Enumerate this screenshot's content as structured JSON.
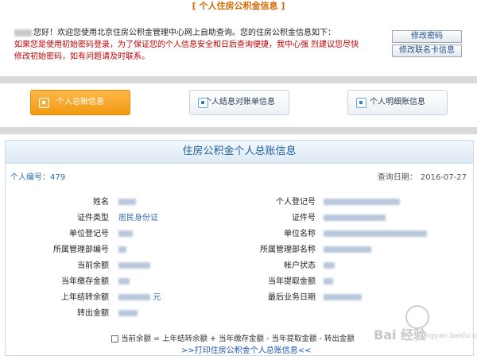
{
  "header": {
    "title": "[ 个人住房公积金信息 ]"
  },
  "greeting": {
    "line1": "您好！欢迎您使用北京住房公积金管理中心网上自助查询。您的住房公积金信息如下：",
    "notice": "如果您是使用初始密码登录，为了保证您的个人信息安全和日后查询便捷，我中心强 烈建议您尽快修改初始密码，如有问题请及时联系。"
  },
  "side_buttons": {
    "change_password": "修改密码",
    "change_card": "修改联名卡信息"
  },
  "tabs": [
    {
      "label": "个人总账信息",
      "active": true
    },
    {
      "label": "个人结息对账单信息",
      "active": false
    },
    {
      "label": "个人明细账信息",
      "active": false
    }
  ],
  "panel": {
    "title": "住房公积金个人总账信息",
    "person_no_label": "个人编号：",
    "person_no": "479",
    "query_date_label": "查询日期：",
    "query_date": "2016-07-27"
  },
  "fields_left": [
    {
      "label": "姓名",
      "value": ""
    },
    {
      "label": "证件类型",
      "value": "居民身份证"
    },
    {
      "label": "单位登记号",
      "value": ""
    },
    {
      "label": "所属管理部编号",
      "value": ""
    },
    {
      "label": "当前余额",
      "value": ""
    },
    {
      "label": "当年缴存金额",
      "value": ""
    },
    {
      "label": "上年结转余额",
      "value": "元"
    },
    {
      "label": "转出金额",
      "value": ""
    }
  ],
  "fields_right": [
    {
      "label": "个人登记号",
      "value": ""
    },
    {
      "label": "证件号",
      "value": ""
    },
    {
      "label": "单位名称",
      "value": ""
    },
    {
      "label": "所属管理部名称",
      "value": ""
    },
    {
      "label": "帐户状态",
      "value": ""
    },
    {
      "label": "当年提取金额",
      "value": ""
    },
    {
      "label": "最后业务日期",
      "value": ""
    }
  ],
  "formula": "当前余额 = 上年结转余额 + 当年缴存金额 - 当年提取金额 - 转出金额",
  "print_link": ">>打印住房公积金个人总账信息<<",
  "watermark": {
    "text": "Bai 经验",
    "sub": "jingyan.baidu.com"
  }
}
